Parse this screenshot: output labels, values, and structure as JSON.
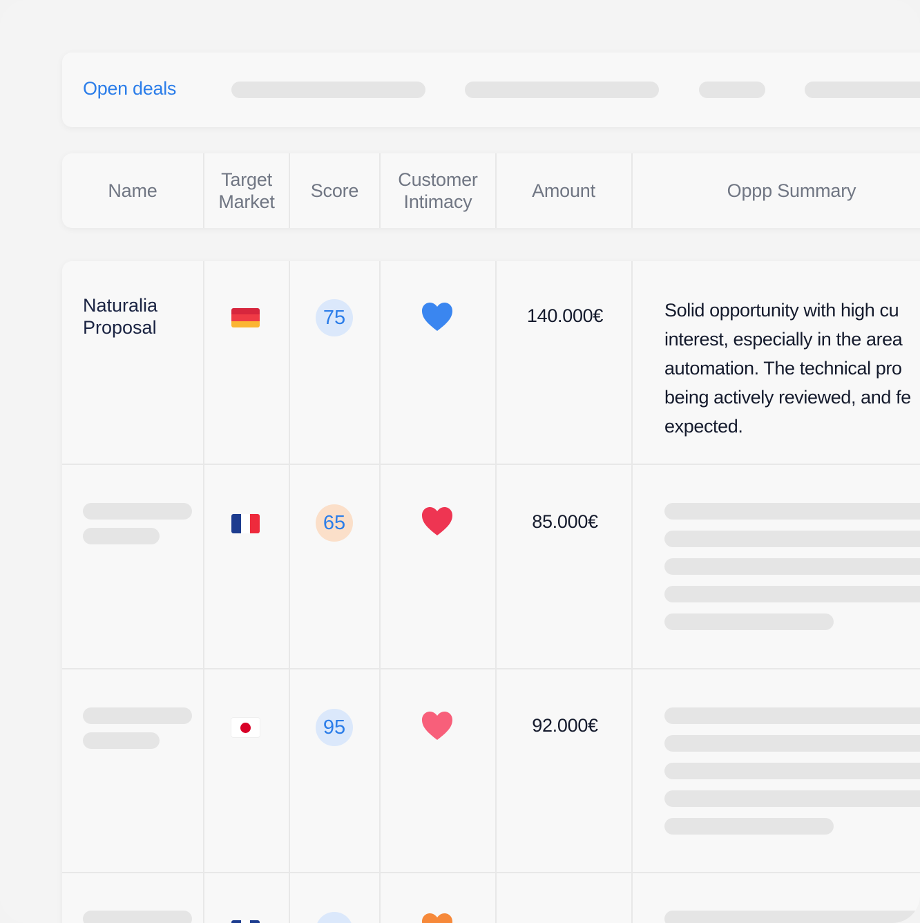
{
  "tabs": {
    "active_label": "Open deals"
  },
  "table": {
    "columns": [
      "Name",
      "Target Market",
      "Score",
      "Customer Intimacy",
      "Amount",
      "Oppp Summary"
    ],
    "rows": [
      {
        "name_lines": [
          "Naturalia",
          "Proposal"
        ],
        "flag": "germany-flag-icon",
        "score": "75",
        "score_color": "#dbe8fb",
        "heart_color": "#3a86f0",
        "amount": "140.000€",
        "summary_lines": [
          "Solid opportunity with high cu",
          "interest, especially in the area",
          "automation. The technical pro",
          "being actively reviewed, and fe",
          "expected."
        ]
      },
      {
        "flag": "france-flag-icon",
        "score": "65",
        "score_color": "#fbdfc9",
        "heart_color": "#ee3552",
        "amount": "85.000€"
      },
      {
        "flag": "japan-flag-icon",
        "score": "95",
        "score_color": "#dbe8fb",
        "heart_color": "#f85f7a",
        "amount": "92.000€"
      }
    ]
  }
}
